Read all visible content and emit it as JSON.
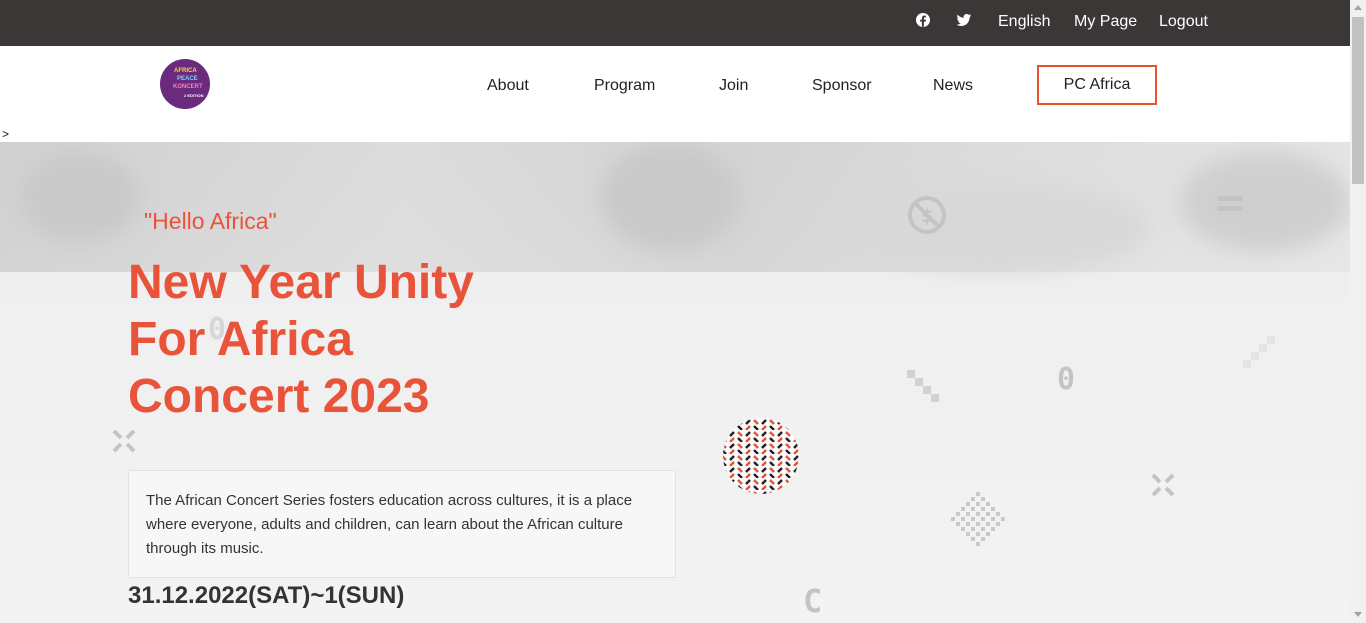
{
  "topbar": {
    "icons": [
      "facebook-icon",
      "twitter-icon"
    ],
    "links": [
      "English",
      "My Page",
      "Logout"
    ]
  },
  "header": {
    "logo_text": [
      "AFRICA",
      "PEACE",
      "KONCERT",
      "2 EDITION"
    ],
    "nav": [
      "About",
      "Program",
      "Join",
      "Sponsor",
      "News",
      "PC Africa"
    ],
    "stray_char": ">"
  },
  "hero": {
    "tagline": "\"Hello Africa\"",
    "title_lines": [
      "New Year Unity",
      "For Africa",
      "Concert 2023"
    ],
    "description": "The African Concert Series fosters education across cultures, it is a place where everyone, adults and children, can learn about the African culture through its music.",
    "date": "31.12.2022(SAT)~1(SUN)"
  },
  "colors": {
    "accent": "#e8533a",
    "topbar_bg": "#3a3736",
    "logo_bg": "#6a2a7e"
  }
}
